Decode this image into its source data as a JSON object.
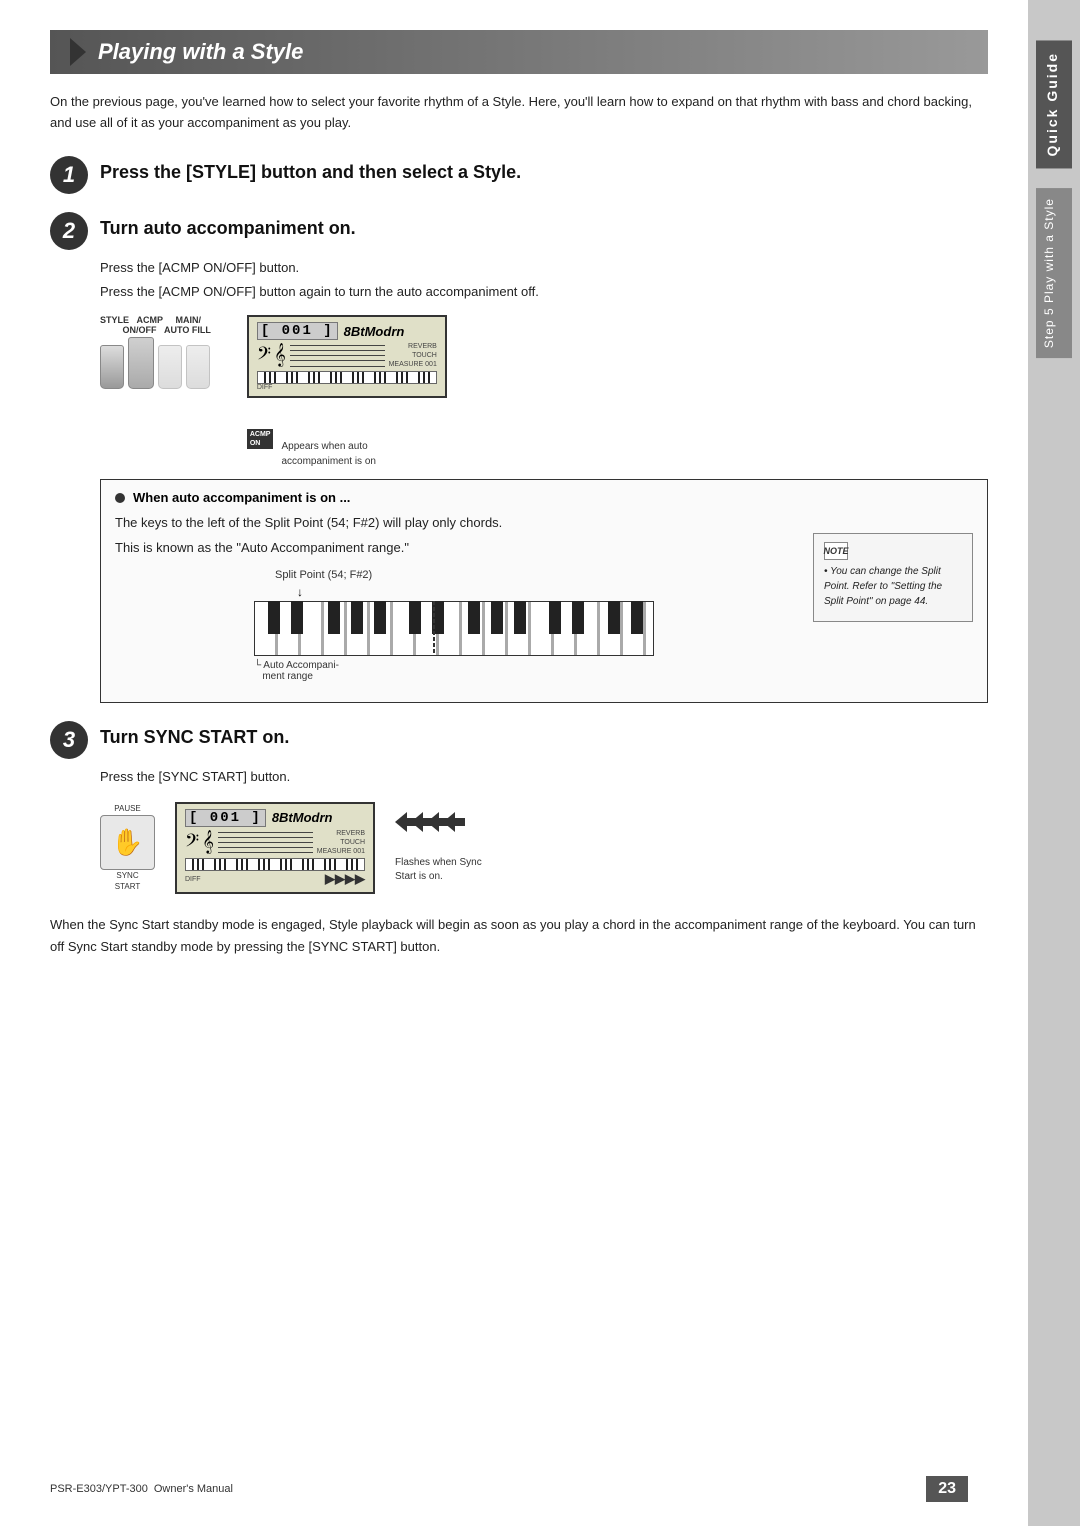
{
  "page": {
    "title": "Playing with a Style",
    "page_number": "23"
  },
  "intro": {
    "text": "On the previous page, you've learned how to select your favorite rhythm of a Style.  Here, you'll learn how to expand on that rhythm with bass and chord backing, and use all of it as your accompaniment as you play."
  },
  "sidebar": {
    "quick_guide_label": "Quick Guide",
    "step5_label": "Step 5  Play with a Style"
  },
  "step1": {
    "number": "1",
    "title": "Press the [STYLE] button and then select a Style."
  },
  "step2": {
    "number": "2",
    "title": "Turn auto accompaniment on.",
    "instructions": [
      "Press the [ACMP ON/OFF] button.",
      "Press the [ACMP ON/OFF] button again to turn the auto accompaniment off."
    ],
    "display": {
      "number": "001",
      "style_name": "8BtModrn",
      "reverb_label": "REVERB",
      "touch_label": "TOUCH",
      "measure_label": "MEASURE",
      "measure_value": "001",
      "diff_label": "DIFF"
    },
    "acmp_label": "ACMP\nON",
    "acmp_description": "Appears when auto\naccompaniment is on",
    "style_button_label": "STYLE",
    "acmp_button_label": "ACMP\nON/OFF",
    "main_auto_fill_label": "MAIN/\nAUTO FILL"
  },
  "auto_acmp_box": {
    "title": "When auto accompaniment is on ...",
    "text1": "The keys to the left of the Split Point (54; F#2) will play only chords.",
    "text2": "This is known as the \"Auto Accompaniment range.\"",
    "split_point_label": "Split Point (54; F#2)",
    "auto_range_label": "Auto Accompaniment range",
    "piano_label_left": "└ Auto Accompani-\n   ment range",
    "note": {
      "title": "NOTE",
      "text": "• You can change the Split Point. Refer to \"Setting the Split Point\" on page 44."
    }
  },
  "step3": {
    "number": "3",
    "title": "Turn SYNC START on.",
    "instruction": "Press the [SYNC START] button.",
    "display": {
      "number": "001",
      "style_name": "8BtModrn",
      "measure_value": "001"
    },
    "sync_button_labels": "PAUSE\nSYNC\nSTART",
    "flash_label": "Flashes when Sync\nStart is on."
  },
  "bottom_text": {
    "text": "When the Sync Start standby mode is engaged, Style playback will begin as soon as you play a chord in the accompaniment range of the keyboard. You can turn off Sync Start standby mode by pressing the [SYNC START] button."
  },
  "footer": {
    "model": "PSR-E303/YPT-300",
    "manual": "Owner's Manual",
    "page": "23"
  }
}
